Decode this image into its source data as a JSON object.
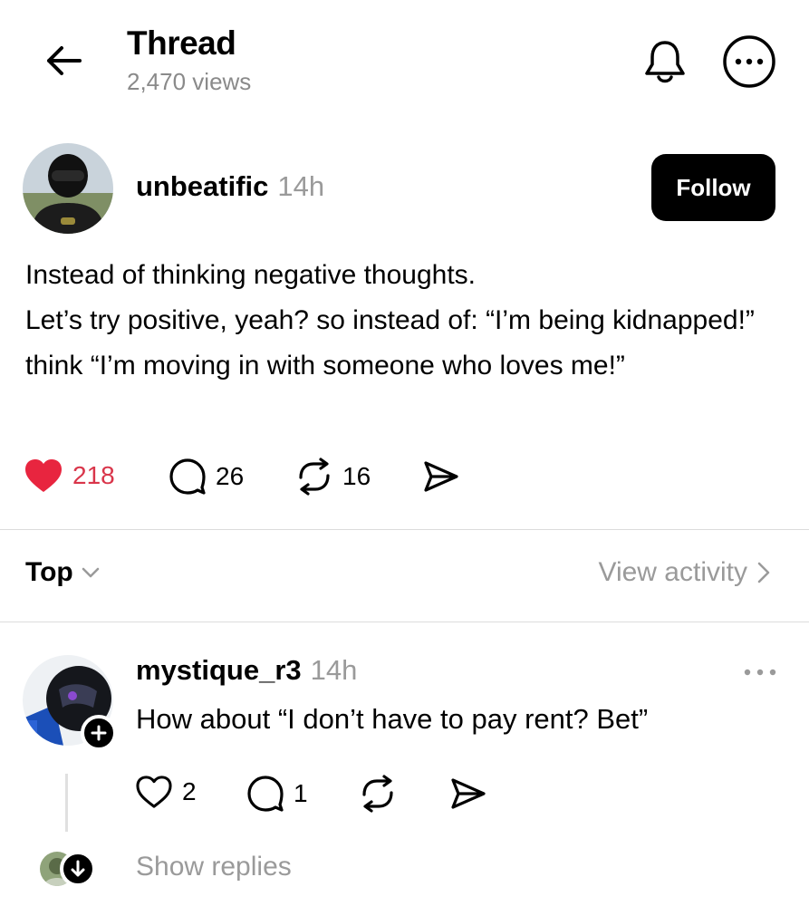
{
  "header": {
    "title": "Thread",
    "views": "2,470 views",
    "icons": {
      "back": "arrow-left-icon",
      "notify": "bell-icon",
      "more": "ellipsis-circle-icon"
    }
  },
  "post": {
    "username": "unbeatific",
    "time": "14h",
    "follow_label": "Follow",
    "text": "Instead of thinking negative thoughts.\nLet’s try positive, yeah? so instead of: “I’m being kidnapped!” think “I’m moving in with someone who loves me!”",
    "likes": "218",
    "comments": "26",
    "reposts": "16",
    "liked": true
  },
  "sort": {
    "label": "Top",
    "view_activity": "View activity"
  },
  "reply": {
    "username": "mystique_r3",
    "time": "14h",
    "text": "How about “I don’t have to pay rent? Bet”",
    "likes": "2",
    "comments": "1"
  },
  "show_replies": "Show replies",
  "colors": {
    "accent_like": "#d9354a",
    "muted_text": "#9a9a9a",
    "button_bg": "#000000",
    "button_text": "#ffffff"
  }
}
